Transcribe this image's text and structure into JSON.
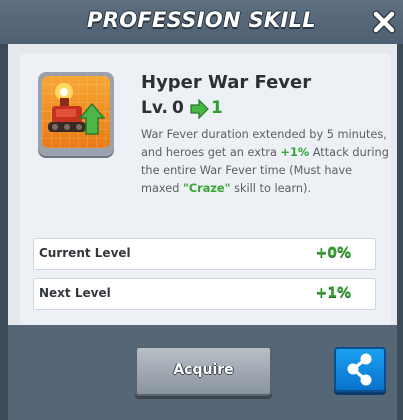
{
  "dialog": {
    "title": "PROFESSION SKILL"
  },
  "skill": {
    "name": "Hyper War Fever",
    "level_label": "Lv.",
    "level_from": "0",
    "level_to": "1",
    "description": {
      "part1": "War Fever duration extended by 5 minutes, and heroes get an extra ",
      "bonus": "+1%",
      "part2": " Attack during the entire War Fever time (Must have maxed ",
      "required_skill": "\"Craze\"",
      "part3": " skill to learn)."
    }
  },
  "stats": [
    {
      "label": "Current Level",
      "value": "+0%"
    },
    {
      "label": "Next Level",
      "value": "+1%"
    }
  ],
  "buttons": {
    "acquire_label": "Acquire"
  },
  "icons": {
    "close": "close-icon",
    "share": "share-icon",
    "skill": "war-tank-skill-icon",
    "level_arrow": "arrow-right-icon"
  },
  "colors": {
    "accent_green": "#36a536",
    "share_blue": "#0a73cc",
    "skill_icon_orange": "#f29228"
  }
}
